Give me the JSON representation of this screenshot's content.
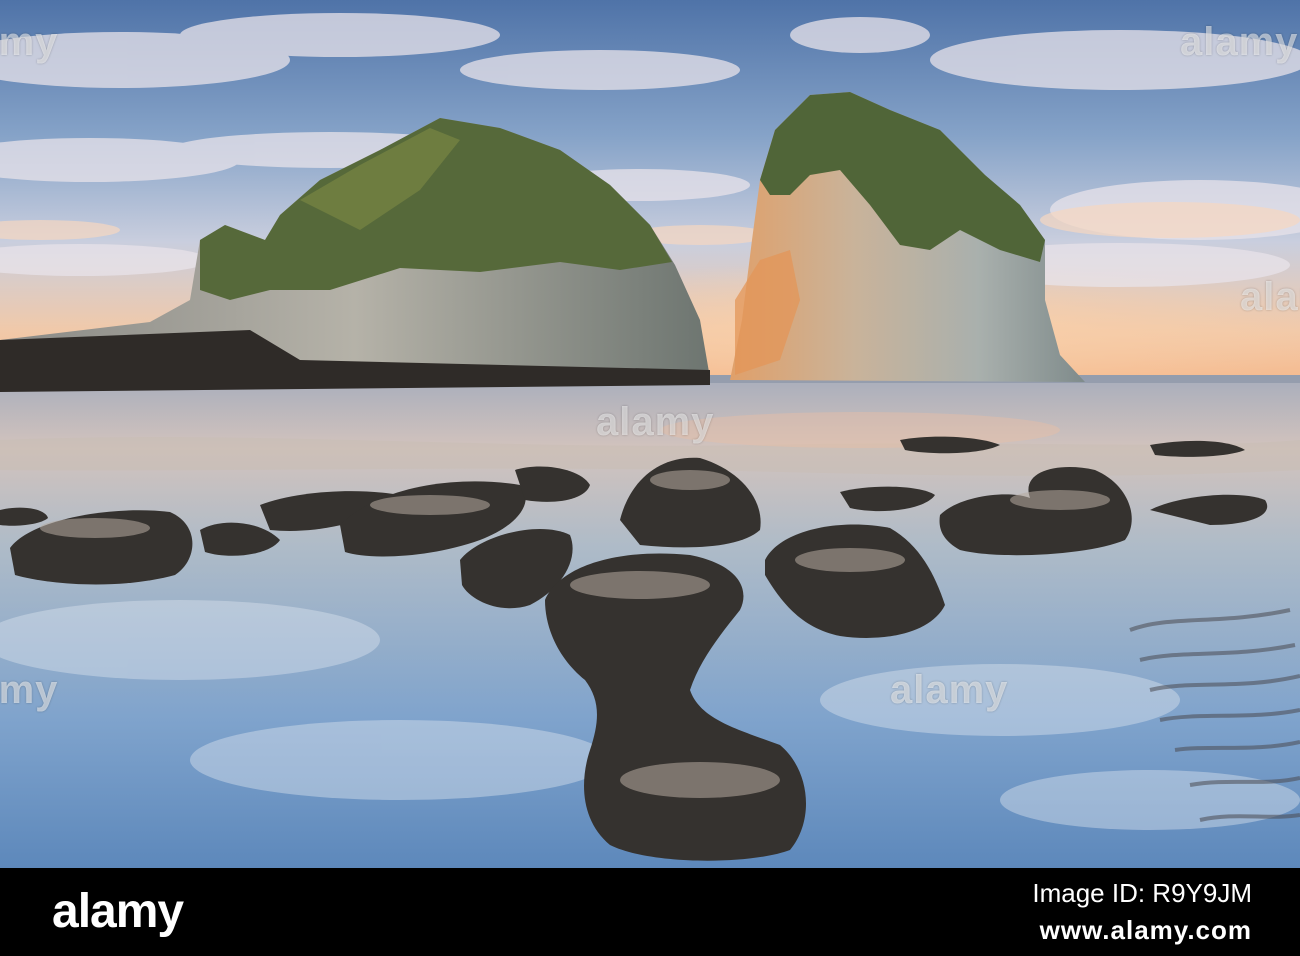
{
  "watermark": {
    "text": "alamy"
  },
  "footer": {
    "brand": "alamy",
    "line1": "Image ID: R9Y9JM",
    "line2": "www.alamy.com"
  },
  "colors": {
    "sky_top": "#5d83b8",
    "sky_horizon": "#f3b98e",
    "water": "#8fb0d2",
    "rock": "#3a3734",
    "vegetation": "#5d6e3a",
    "cliff_lit": "#d99f6a"
  }
}
